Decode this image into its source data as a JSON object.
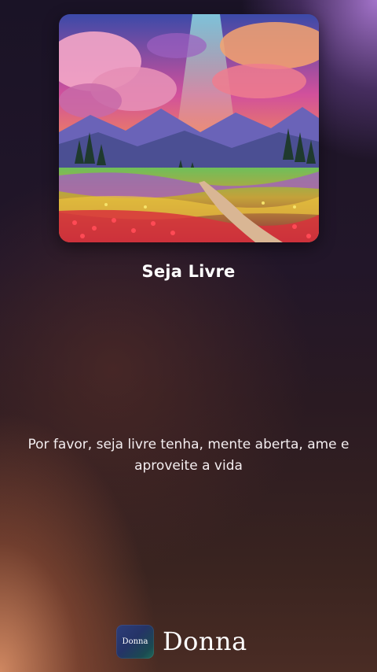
{
  "player": {
    "cover_art": "landscape-painting-sunset-flower-field-path",
    "song_title": "Seja Livre",
    "lyrics_line": "Por favor, seja livre tenha, mente aberta, ame e aproveite a vida"
  },
  "brand": {
    "badge_text": "Donna",
    "name": "Donna"
  },
  "colors": {
    "background_top": "#1a1326",
    "glow_bottom_left": "#d68c64",
    "glow_top_right": "#aa78d2",
    "text": "#ffffff",
    "brand_badge": "#253467"
  }
}
